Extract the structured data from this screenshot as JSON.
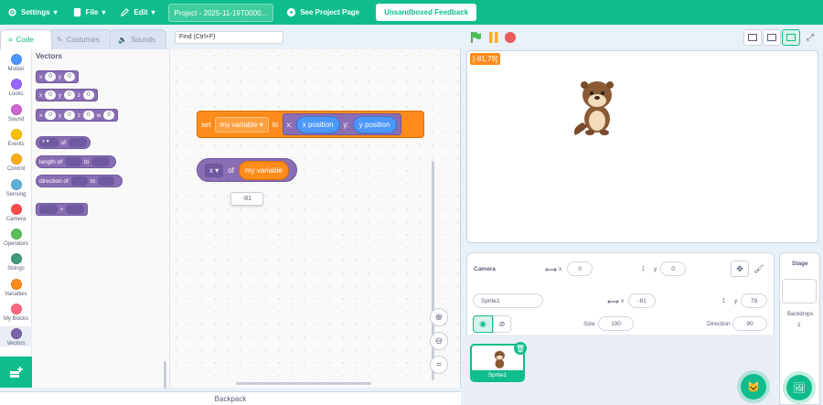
{
  "menu": {
    "settings": "Settings",
    "file": "File",
    "edit": "Edit",
    "project_title": "Project - 2025-11-19T0000...",
    "see_project": "See Project Page",
    "feedback": "Unsandboxed Feedback"
  },
  "tabs": {
    "code": "Code",
    "costumes": "Costumes",
    "sounds": "Sounds"
  },
  "find": {
    "placeholder": "Find (Ctrl+F)"
  },
  "categories": [
    {
      "label": "Motion",
      "color": "#4c97ff"
    },
    {
      "label": "Looks",
      "color": "#9966ff"
    },
    {
      "label": "Sound",
      "color": "#cf63cf"
    },
    {
      "label": "Events",
      "color": "#ffbf00"
    },
    {
      "label": "Control",
      "color": "#ffab19"
    },
    {
      "label": "Sensing",
      "color": "#5cb1d6"
    },
    {
      "label": "Camera",
      "color": "#ff4d4d"
    },
    {
      "label": "Operators",
      "color": "#59c059"
    },
    {
      "label": "Strings",
      "color": "#3f9a7d"
    },
    {
      "label": "Variables",
      "color": "#ff8c1a"
    },
    {
      "label": "My Blocks",
      "color": "#ff6680"
    },
    {
      "label": "Vectors",
      "color": "#7b64a8"
    }
  ],
  "palette": {
    "header": "Vectors",
    "x": "x",
    "y": "y",
    "z": "z",
    "w": "w",
    "zero": "0",
    "length_of": "length of",
    "to": "to",
    "direction_of": "direction of",
    "of": "of",
    "plus": "+"
  },
  "script": {
    "set": "set",
    "my_variable": "my variable",
    "to": "to",
    "x_colon": "x:",
    "y_colon": "y:",
    "x_position": "x position",
    "y_position": "y position",
    "x_drop": "x",
    "of": "of",
    "tooltip_value": "-81"
  },
  "backpack": "Backpack",
  "stage": {
    "coords": "[-81,79]"
  },
  "camera": {
    "label": "Camera",
    "x_label": "x",
    "x": "0",
    "y_label": "y",
    "y": "0"
  },
  "sprite": {
    "name": "Sprite1",
    "x_label": "x",
    "x": "-81",
    "y_label": "y",
    "y": "79",
    "size_label": "Size",
    "size": "100",
    "direction_label": "Direction",
    "direction": "90",
    "thumb_label": "Sprite1"
  },
  "stage_panel": {
    "title": "Stage",
    "backdrops_label": "Backdrops",
    "backdrops": "1"
  },
  "colors": {
    "accent": "#0fbd8c",
    "vectors": "#8a6eb3",
    "variables": "#ff8c1a",
    "motion": "#4c97ff"
  }
}
